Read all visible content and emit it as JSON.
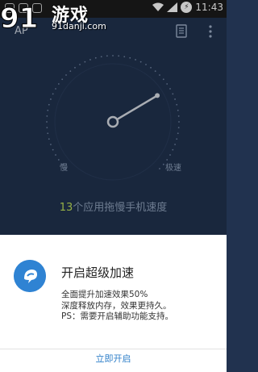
{
  "status_bar": {
    "time": "11:43",
    "battery_label": "⚡"
  },
  "watermark": {
    "brand_text": "游戏",
    "url": "91danji.com"
  },
  "app_bar": {
    "title": "AP"
  },
  "gauge": {
    "label_slow": "慢",
    "label_fast": "极速",
    "needle_level": 0.72,
    "status_count": "13",
    "status_text": "个应用拖慢手机速度"
  },
  "sheet": {
    "title": "开启超级加速",
    "body_line_1": "全面提升加速效果50%",
    "body_line_2": "深度释放内存，效果更持久。",
    "body_line_3": "PS：需要开启辅助功能支持。",
    "action_label": "立即开启"
  },
  "colors": {
    "background": "#21324f",
    "accent_blue": "#2f83d3",
    "count_green": "#bfe15a"
  }
}
